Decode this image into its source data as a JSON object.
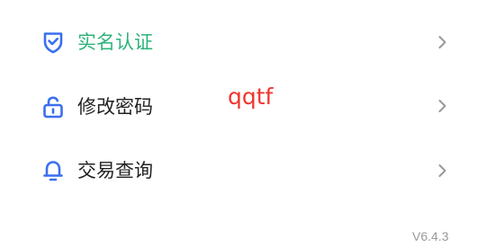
{
  "menu": {
    "items": [
      {
        "label": "实名认证",
        "icon": "shield-check-icon",
        "color": "#2db37a"
      },
      {
        "label": "修改密码",
        "icon": "lock-icon",
        "color": "#222222"
      },
      {
        "label": "交易查询",
        "icon": "bell-icon",
        "color": "#222222"
      }
    ]
  },
  "overlay": {
    "text": "qqtf",
    "color": "#f0342c"
  },
  "footer": {
    "version": "V6.4.3"
  },
  "colors": {
    "icon_blue": "#3a6ff0",
    "chevron": "#999999"
  }
}
